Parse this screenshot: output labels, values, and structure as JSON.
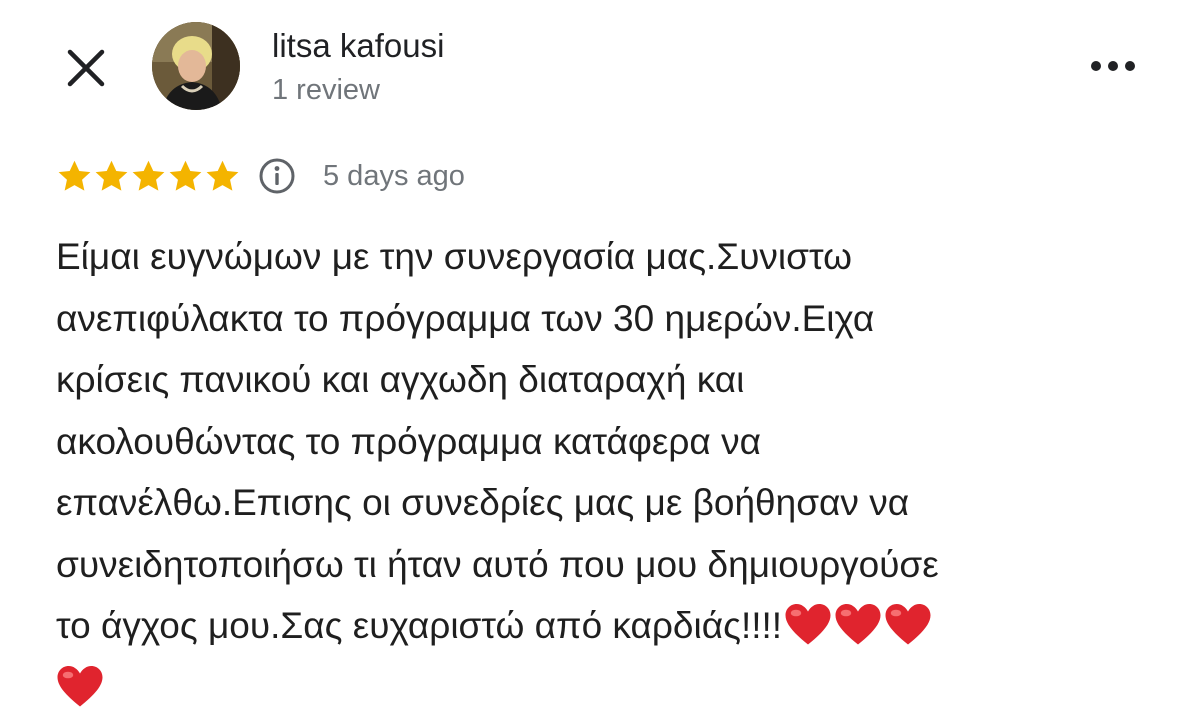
{
  "header": {
    "reviewer_name": "litsa kafousi",
    "review_count": "1 review",
    "close_icon": "close-icon",
    "more_icon": "more-horizontal-icon"
  },
  "rating": {
    "stars": 5,
    "max_stars": 5,
    "star_color": "#f4b400"
  },
  "meta": {
    "info_icon": "info-icon",
    "date": "5 days ago"
  },
  "review": {
    "lines": [
      "Είμαι ευγνώμων με την συνεργασία μας.Συνιστω",
      "ανεπιφύλακτα το πρόγραμμα των 30 ημερών.Ειχα",
      "κρίσεις πανικού και αγχωδη διαταραχή και",
      "ακολουθώντας το πρόγραμμα κατάφερα να",
      "επανέλθω.Επισης οι συνεδρίες μας με βοήθησαν να",
      "συνειδητοποιήσω τι ήταν αυτό που μου δημιουργούσε",
      "το άγχος μου.Σας ευχαριστώ από καρδιάς!!!!"
    ],
    "heart_emoji": "❤️",
    "heart_count": 4,
    "heart_color": "#e0242e"
  }
}
